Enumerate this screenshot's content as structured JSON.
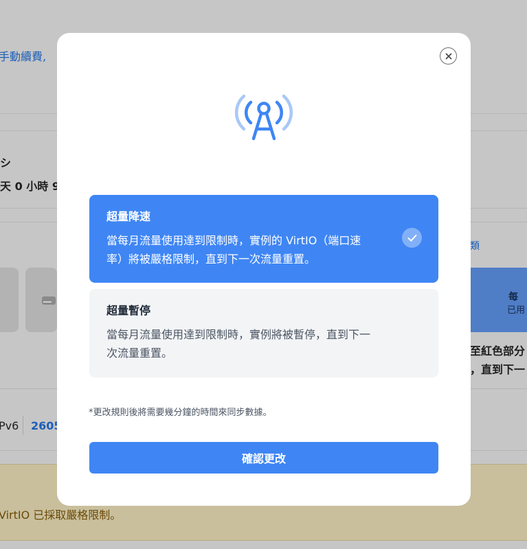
{
  "background": {
    "line1": "手動續費,",
    "line2": "シ",
    "line3": "天 0 小時 9",
    "link_fragment": "類",
    "blue_box_line1": "每",
    "blue_box_line2": "已用",
    "note_line1": "至紅色部分",
    "note_line2": "，直到下一",
    "ip_label": "Pv6",
    "ip_value": "2605",
    "warning_text": "VirtIO 已採取嚴格限制。"
  },
  "modal": {
    "close_icon": "close-icon",
    "hero_icon": "broadcast-tower-icon",
    "accent_color": "#3f86f4",
    "options": [
      {
        "title": "超量降速",
        "description": "當每月流量使用達到限制時，實例的 VirtIO（端口速率）將被嚴格限制，直到下一次流量重置。",
        "selected": true,
        "icon": "check-icon"
      },
      {
        "title": "超量暫停",
        "description": "當每月流量使用達到限制時，實例將被暫停，直到下一次流量重置。",
        "selected": false
      }
    ],
    "footnote": "*更改規則後將需要幾分鐘的時間來同步數據。",
    "confirm_label": "確認更改"
  }
}
